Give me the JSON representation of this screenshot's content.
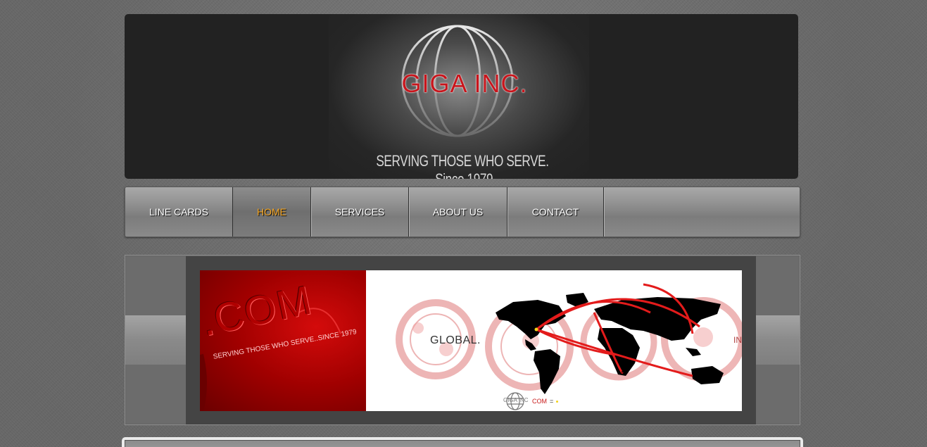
{
  "header": {
    "logo_text": "GIGA INC.",
    "tagline": "SERVING THOSE WHO SERVE. .Since 1979"
  },
  "nav": {
    "items": [
      {
        "label": "LINE CARDS"
      },
      {
        "label": "HOME"
      },
      {
        "label": "SERVICES"
      },
      {
        "label": "ABOUT US"
      },
      {
        "label": "CONTACT"
      }
    ],
    "active": "HOME"
  },
  "slider": {
    "left_panel_text": ".COM",
    "left_panel_tagline": "SERVING THOSE WHO SERVE..SINCE 1979",
    "global_text": "GLOBAL.",
    "footer_logo_text": "GIGA INC",
    "footer_com_text": "COM",
    "footer_equals": "=",
    "right_edge_text": "IN"
  },
  "colors": {
    "brand_red": "#c8151c",
    "nav_active": "#f5a623",
    "header_bg": "#222222"
  }
}
